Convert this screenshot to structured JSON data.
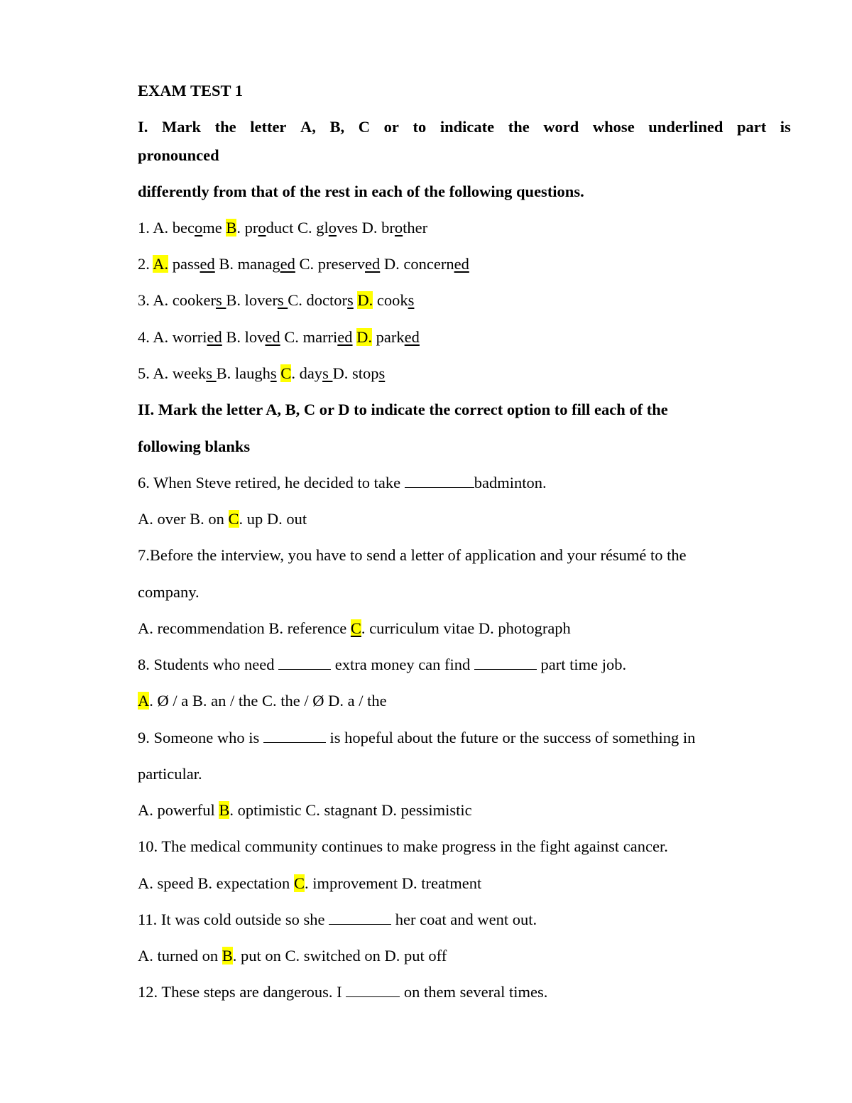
{
  "title": "EXAM TEST 1",
  "section1": {
    "heading_line1_words": [
      "I.",
      "Mark",
      "the",
      "letter",
      "A,",
      "B,",
      "C",
      "or",
      "to",
      "indicate",
      "the",
      "word",
      "whose",
      "underlined",
      "part",
      "is"
    ],
    "heading_line2": "pronounced",
    "heading_line3": "differently from that of the rest in each of the following questions.",
    "questions": [
      {
        "number": "1.",
        "answer": "B",
        "options": [
          {
            "letter": "A",
            "pre": "bec",
            "ul": "o",
            "post": "me"
          },
          {
            "letter": "B",
            "pre": "pr",
            "ul": "o",
            "post": "duct"
          },
          {
            "letter": "C",
            "pre": "gl",
            "ul": "o",
            "post": "ves"
          },
          {
            "letter": "D",
            "pre": "br",
            "ul": "o",
            "post": "ther"
          }
        ]
      },
      {
        "number": "2.",
        "answer": "A",
        "options": [
          {
            "letter": "A",
            "pre": "pass",
            "ul": "ed",
            "post": ""
          },
          {
            "letter": "B",
            "pre": "manag",
            "ul": "ed",
            "post": ""
          },
          {
            "letter": "C",
            "pre": "preserv",
            "ul": "ed",
            "post": ""
          },
          {
            "letter": "D",
            "pre": "concern",
            "ul": "ed",
            "post": ""
          }
        ]
      },
      {
        "number": "3.",
        "answer": "D",
        "options": [
          {
            "letter": "A",
            "pre": "cooker",
            "ul": "s ",
            "post": ""
          },
          {
            "letter": "B",
            "pre": "lover",
            "ul": "s ",
            "post": ""
          },
          {
            "letter": "C",
            "pre": "doctor",
            "ul": "s",
            "post": ""
          },
          {
            "letter": "D",
            "pre": "cook",
            "ul": "s",
            "post": ""
          }
        ]
      },
      {
        "number": "4.",
        "answer": "D",
        "options": [
          {
            "letter": "A",
            "pre": "worri",
            "ul": "ed",
            "post": ""
          },
          {
            "letter": "B",
            "pre": "lov",
            "ul": "ed",
            "post": ""
          },
          {
            "letter": "C",
            "pre": "marri",
            "ul": "ed",
            "post": ""
          },
          {
            "letter": "D",
            "pre": "park",
            "ul": "ed",
            "post": ""
          }
        ]
      },
      {
        "number": "5.",
        "answer": "C",
        "options": [
          {
            "letter": "A",
            "pre": "week",
            "ul": "s ",
            "post": ""
          },
          {
            "letter": "B",
            "pre": "laugh",
            "ul": "s",
            "post": ""
          },
          {
            "letter": "C",
            "pre": "day",
            "ul": "s ",
            "post": ""
          },
          {
            "letter": "D",
            "pre": "stop",
            "ul": "s",
            "post": ""
          }
        ]
      }
    ]
  },
  "section2": {
    "heading_line1": "II. Mark the letter A, B, C or D to indicate the correct option to fill each of the",
    "heading_line2": "following blanks",
    "q6": {
      "stem_pre": "6. When Steve retired, he decided to take ",
      "stem_post": "badminton.",
      "options": [
        "A. over",
        "B. on",
        "C",
        ". up",
        "D. out"
      ]
    },
    "q7": {
      "stem_line1": "7.Before the interview, you have to send a letter of application and your résumé to the",
      "stem_line2": "company.",
      "opt_pre": "A. recommendation B. reference ",
      "answer": "C",
      "opt_post": ". curriculum vitae D. photograph"
    },
    "q8": {
      "stem_a": "8. Students who need ",
      "stem_b": " extra money can find ",
      "stem_c": " part time job.",
      "answer": "A",
      "opt_post": ". Ø / a B. an / the C. the / Ø D. a / the"
    },
    "q9": {
      "stem_a": "9. Someone who is ",
      "stem_b": " is hopeful about the future or the success of something in",
      "stem_line2": "particular.",
      "opt_pre": "A. powerful ",
      "answer": "B",
      "opt_post": ". optimistic C. stagnant D. pessimistic"
    },
    "q10": {
      "stem": "10. The medical community continues to make progress in the fight against cancer.",
      "opt_pre": "A. speed B. expectation ",
      "answer": "C",
      "opt_post": ". improvement D. treatment"
    },
    "q11": {
      "stem_a": "11. It was cold outside so she ",
      "stem_b": " her coat and went out.",
      "opt_pre": "A. turned on ",
      "answer": "B",
      "opt_post": ". put on C. switched on D. put off"
    },
    "q12": {
      "stem_a": "12. These steps are dangerous. I ",
      "stem_b": " on them several times."
    }
  },
  "highlight_color": "#ffff00"
}
